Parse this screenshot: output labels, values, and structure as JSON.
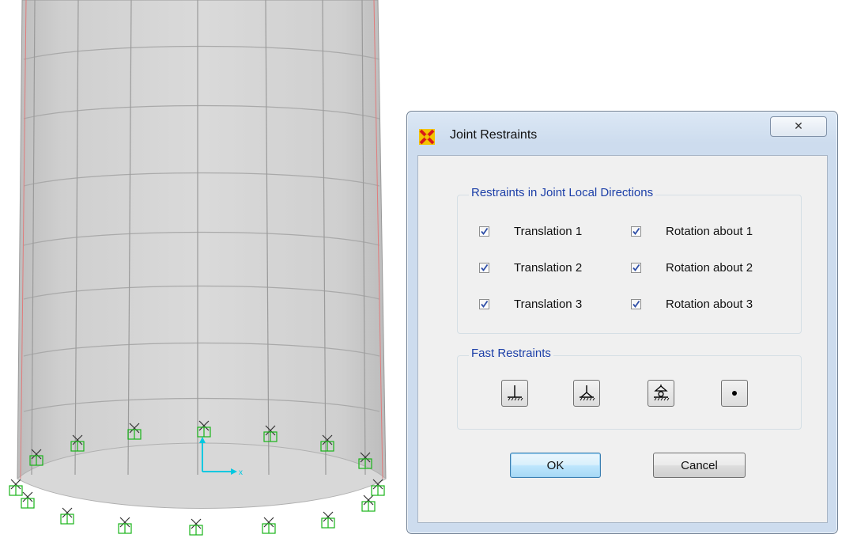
{
  "dialog": {
    "title": "Joint Restraints",
    "close_label": "✕",
    "local_group_label": "Restraints in Joint Local Directions",
    "fast_group_label": "Fast Restraints",
    "restraints": [
      {
        "label": "Translation 1",
        "checked": true
      },
      {
        "label": "Rotation about 1",
        "checked": true
      },
      {
        "label": "Translation 2",
        "checked": true
      },
      {
        "label": "Rotation about 2",
        "checked": true
      },
      {
        "label": "Translation 3",
        "checked": true
      },
      {
        "label": "Rotation about 3",
        "checked": true
      }
    ],
    "fast_restraints": [
      "fixed-support-icon",
      "pin-support-icon",
      "roller-support-icon",
      "free-joint-icon"
    ],
    "ok_label": "OK",
    "cancel_label": "Cancel"
  },
  "viewport": {
    "axis_label": "x",
    "colors": {
      "shell_fill": "#d0d0d0",
      "edge": "#9a9a9a",
      "restraint_symbol": "#18b418",
      "axis": "#00c8e0"
    }
  }
}
